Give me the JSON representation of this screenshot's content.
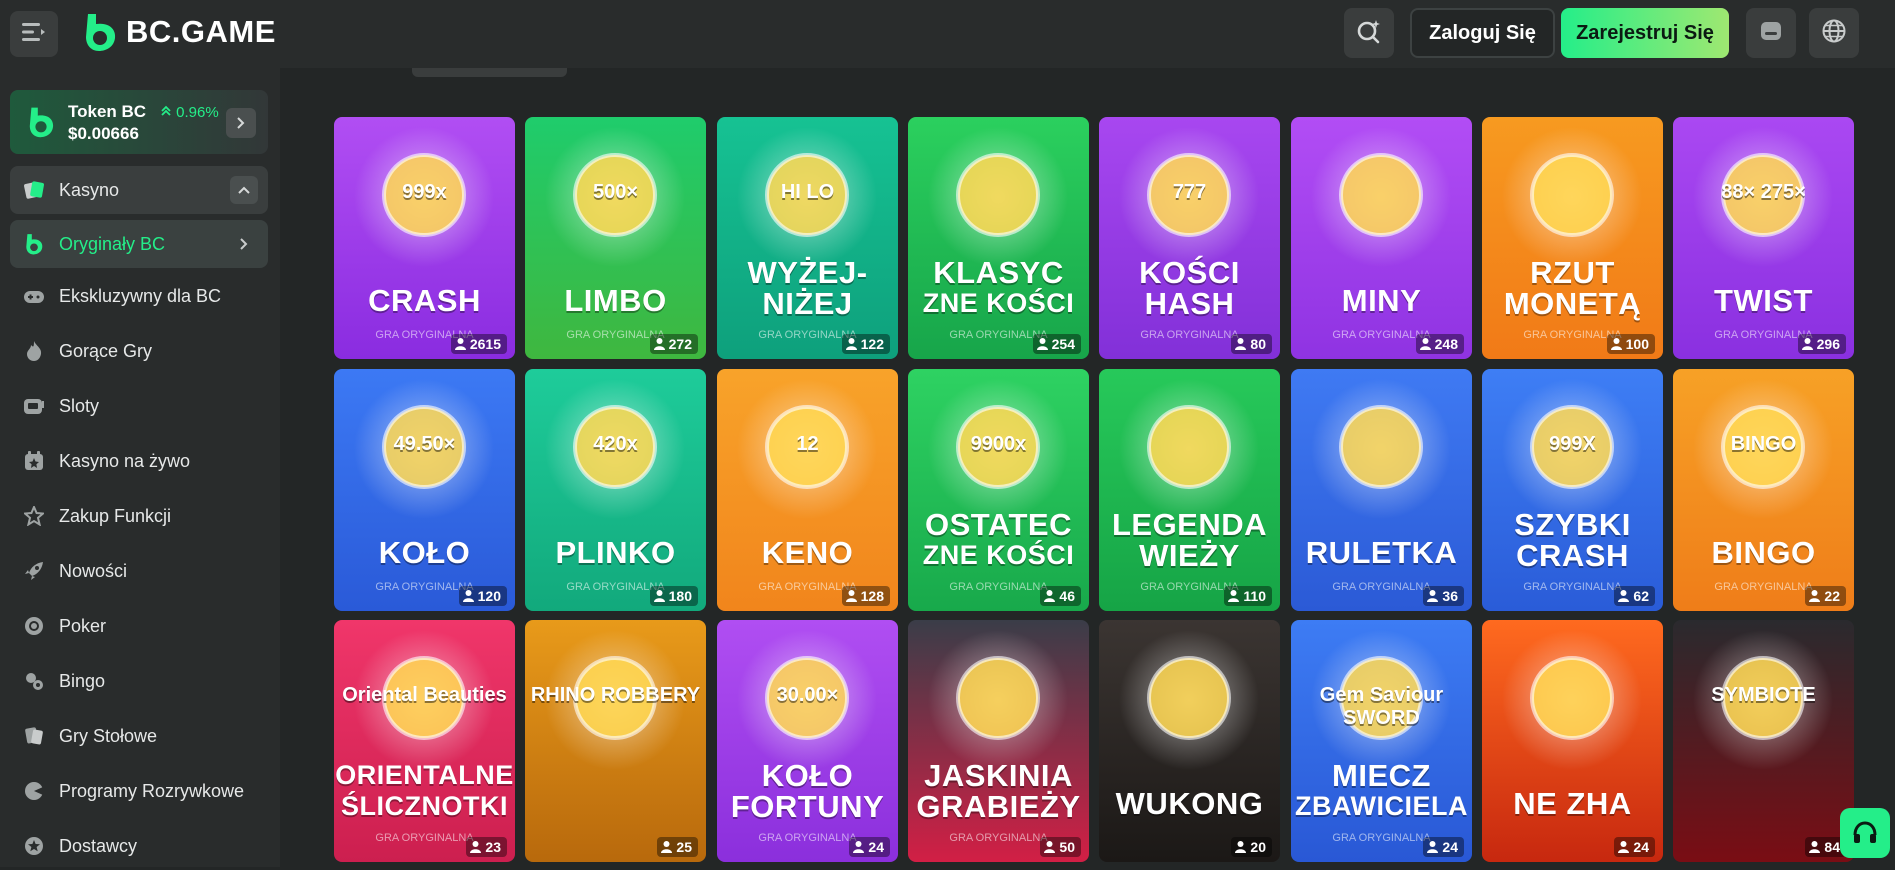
{
  "header": {
    "brand": "BC.GAME",
    "login_label": "Zaloguj Się",
    "register_label": "Zarejestruj Się",
    "icons": [
      "menu-icon",
      "search-icon",
      "chat-icon",
      "globe-icon"
    ]
  },
  "sidebar": {
    "token": {
      "name": "Token BC",
      "change": "0.96%",
      "price": "$0.00666"
    },
    "casino_label": "Kasyno",
    "items": [
      {
        "label": "Oryginały BC",
        "icon": "bc-logo-icon",
        "active": true
      },
      {
        "label": "Ekskluzywny dla BC",
        "icon": "gamepad-icon"
      },
      {
        "label": "Gorące Gry",
        "icon": "fire-icon"
      },
      {
        "label": "Sloty",
        "icon": "slot-machine-icon"
      },
      {
        "label": "Kasyno na żywo",
        "icon": "live-casino-icon"
      },
      {
        "label": "Zakup Funkcji",
        "icon": "star-icon"
      },
      {
        "label": "Nowości",
        "icon": "rocket-icon"
      },
      {
        "label": "Poker",
        "icon": "poker-chip-icon"
      },
      {
        "label": "Bingo",
        "icon": "bingo-icon"
      },
      {
        "label": "Gry Stołowe",
        "icon": "table-games-icon"
      },
      {
        "label": "Programy Rozrywkowe",
        "icon": "game-show-icon"
      },
      {
        "label": "Dostawcy",
        "icon": "providers-icon"
      }
    ]
  },
  "games": [
    {
      "title": [
        "CRASH"
      ],
      "count": "2615",
      "sub": "GRA ORYGINALNA",
      "bg": [
        "#b14ef3",
        "#8a2ce0"
      ],
      "art": "999x"
    },
    {
      "title": [
        "LIMBO"
      ],
      "count": "272",
      "sub": "GRA ORYGINALNA",
      "bg": [
        "#1fcc6c",
        "#3fb73f"
      ],
      "art": "500×"
    },
    {
      "title": [
        "WYŻEJ-",
        "NIŻEJ"
      ],
      "count": "122",
      "sub": "GRA ORYGINALNA",
      "bg": [
        "#16c293",
        "#0ea07c"
      ],
      "art": "HI LO"
    },
    {
      "title": [
        "KLASYC",
        "ZNE KOŚCI"
      ],
      "count": "254",
      "sub": "GRA ORYGINALNA",
      "bg": [
        "#2bd05e",
        "#17a54a"
      ],
      "art": ""
    },
    {
      "title": [
        "KOŚCI",
        "HASH"
      ],
      "count": "80",
      "sub": "GRA ORYGINALNA",
      "bg": [
        "#a847f0",
        "#8230d8"
      ],
      "art": "777"
    },
    {
      "title": [
        "MINY"
      ],
      "count": "248",
      "sub": "GRA ORYGINALNA",
      "bg": [
        "#b24df5",
        "#8f33e2"
      ],
      "art": ""
    },
    {
      "title": [
        "RZUT",
        "MONETĄ"
      ],
      "count": "100",
      "sub": "GRA ORYGINALNA",
      "bg": [
        "#f79a20",
        "#f17a17"
      ],
      "art": ""
    },
    {
      "title": [
        "TWIST"
      ],
      "count": "296",
      "sub": "GRA ORYGINALNA",
      "bg": [
        "#aa48f2",
        "#8a30e0"
      ],
      "art": "88× 275×"
    },
    {
      "title": [
        "KOŁO"
      ],
      "count": "120",
      "sub": "GRA ORYGINALNA",
      "bg": [
        "#3c79f4",
        "#2a5ad8"
      ],
      "art": "49.50×"
    },
    {
      "title": [
        "PLINKO"
      ],
      "count": "180",
      "sub": "GRA ORYGINALNA",
      "bg": [
        "#1ecc9a",
        "#12a97c"
      ],
      "art": "420x"
    },
    {
      "title": [
        "KENO"
      ],
      "count": "128",
      "sub": "GRA ORYGINALNA",
      "bg": [
        "#f8a32a",
        "#f1851c"
      ],
      "art": "12"
    },
    {
      "title": [
        "OSTATEC",
        "ZNE KOŚCI"
      ],
      "count": "46",
      "sub": "GRA ORYGINALNA",
      "bg": [
        "#2ed262",
        "#18a94b"
      ],
      "art": "9900x"
    },
    {
      "title": [
        "LEGENDA",
        "WIEŻY"
      ],
      "count": "110",
      "sub": "GRA ORYGINALNA",
      "bg": [
        "#27c95a",
        "#16a446"
      ],
      "art": ""
    },
    {
      "title": [
        "RULETKA"
      ],
      "count": "36",
      "sub": "GRA ORYGINALNA",
      "bg": [
        "#3f7af3",
        "#2b5ad6"
      ],
      "art": ""
    },
    {
      "title": [
        "SZYBKI",
        "CRASH"
      ],
      "count": "62",
      "sub": "GRA ORYGINALNA",
      "bg": [
        "#3e7ef5",
        "#2a5cd8"
      ],
      "art": "999X"
    },
    {
      "title": [
        "BINGO"
      ],
      "count": "22",
      "sub": "GRA ORYGINALNA",
      "bg": [
        "#f7a126",
        "#ef7d19"
      ],
      "art": "BINGO"
    },
    {
      "title": [
        "ORIENTALNE",
        "ŚLICZNOTKI"
      ],
      "count": "23",
      "sub": "GRA ORYGINALNA",
      "bg": [
        "#f0366a",
        "#cc1f4f"
      ],
      "art": "Oriental Beauties"
    },
    {
      "title": [],
      "count": "25",
      "sub": "",
      "bg": [
        "#e89a1a",
        "#b8690c"
      ],
      "art": "RHINO ROBBERY"
    },
    {
      "title": [
        "KOŁO",
        "FORTUNY"
      ],
      "count": "24",
      "sub": "GRA ORYGINALNA",
      "bg": [
        "#b04ef2",
        "#8b2fdc"
      ],
      "art": "30.00×"
    },
    {
      "title": [
        "JASKINIA",
        "GRABIEŻY"
      ],
      "count": "50",
      "sub": "GRA ORYGINALNA",
      "bg": [
        "#3a3d48",
        "#d21f45"
      ],
      "art": ""
    },
    {
      "title": [
        "WUKONG"
      ],
      "count": "20",
      "sub": "",
      "bg": [
        "#3b3532",
        "#1b1816"
      ],
      "art": ""
    },
    {
      "title": [
        "MIECZ",
        "ZBAWICIELA"
      ],
      "count": "24",
      "sub": "GRA ORYGINALNA",
      "bg": [
        "#3d7cf4",
        "#2958d5"
      ],
      "art": "Gem Saviour SWORD"
    },
    {
      "title": [
        "NE ZHA"
      ],
      "count": "24",
      "sub": "",
      "bg": [
        "#ff6a1f",
        "#c7280f"
      ],
      "art": ""
    },
    {
      "title": [],
      "count": "84",
      "sub": "",
      "bg": [
        "#2a2a2e",
        "#7a0d14"
      ],
      "art": "SYMBIOTE"
    }
  ]
}
